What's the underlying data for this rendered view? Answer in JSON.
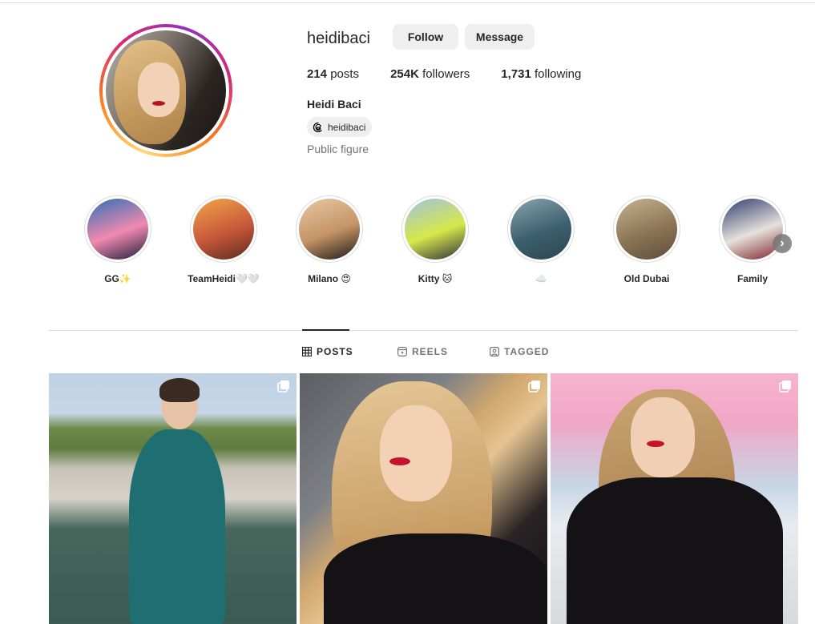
{
  "profile": {
    "username": "heidibaci",
    "follow_label": "Follow",
    "message_label": "Message",
    "posts_count": "214",
    "posts_word": " posts",
    "followers_count": "254K",
    "followers_word": " followers",
    "following_count": "1,731",
    "following_word": " following",
    "full_name": "Heidi Baci",
    "threads_handle": "heidibaci",
    "category": "Public figure"
  },
  "highlights": [
    {
      "label": "GG✨",
      "colors": [
        "#2d6fb6",
        "#f08ab0",
        "#1c1d3a"
      ]
    },
    {
      "label": "TeamHeidi🤍🤍",
      "colors": [
        "#f2a54a",
        "#c8583a",
        "#5a2a1e"
      ]
    },
    {
      "label": "Milano 😍",
      "colors": [
        "#e8c8a4",
        "#c49466",
        "#1a1716"
      ]
    },
    {
      "label": "Kitty 🐱",
      "colors": [
        "#9fc2e0",
        "#d6e84a",
        "#2c2c3a"
      ]
    },
    {
      "label": "☁️",
      "colors": [
        "#8aa3b2",
        "#3d5f6d",
        "#2c4552"
      ]
    },
    {
      "label": "Old Dubai",
      "colors": [
        "#c6b28f",
        "#8c7556",
        "#5b4c3a"
      ]
    },
    {
      "label": "Family",
      "colors": [
        "#2f3c6e",
        "#e6e1db",
        "#7a1e26"
      ]
    }
  ],
  "tabs": [
    {
      "label": "POSTS",
      "icon": "grid-icon",
      "active": true
    },
    {
      "label": "REELS",
      "icon": "reels-icon",
      "active": false
    },
    {
      "label": "TAGGED",
      "icon": "tagged-icon",
      "active": false
    }
  ],
  "colors": {
    "button_bg": "#efefef",
    "text_primary": "#262626",
    "text_secondary": "#737373",
    "divider": "#dbdbdb"
  }
}
